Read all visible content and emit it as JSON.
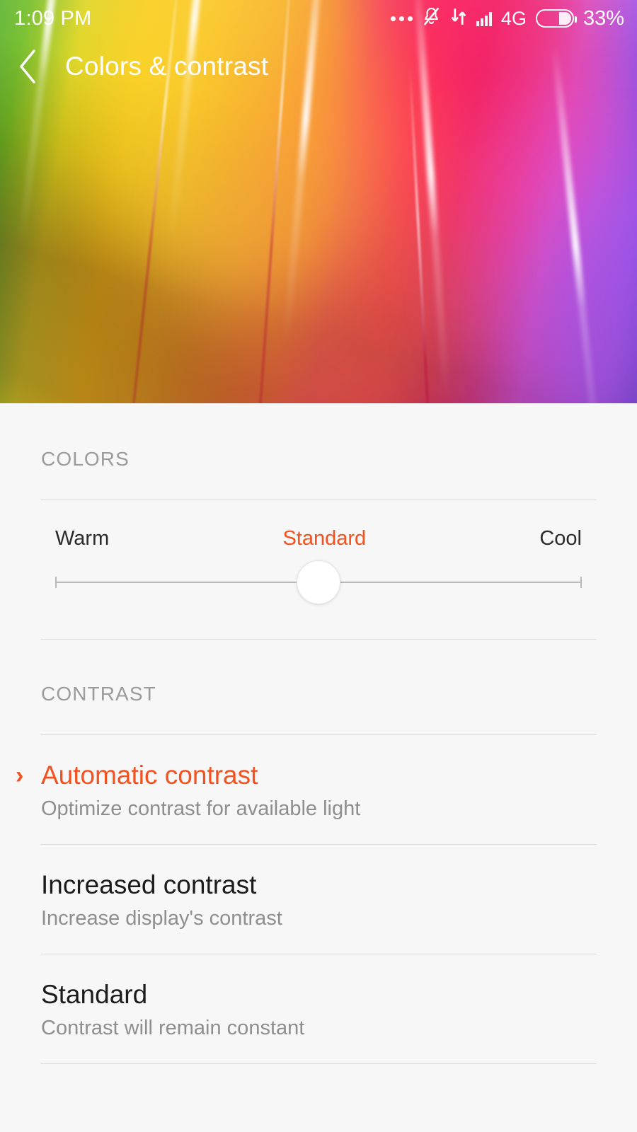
{
  "status_bar": {
    "time": "1:09 PM",
    "network_label": "4G",
    "battery_percent": "33%",
    "battery_level": 33,
    "icons": [
      "more-dots-icon",
      "bell-muted-icon",
      "data-transfer-icon",
      "signal-bars-icon",
      "battery-icon"
    ]
  },
  "app_bar": {
    "back_icon": "chevron-left-icon",
    "title": "Colors & contrast"
  },
  "colors_section": {
    "label": "COLORS",
    "slider": {
      "left_label": "Warm",
      "center_label": "Standard",
      "right_label": "Cool",
      "selected": "Standard",
      "position_percent": 50
    }
  },
  "contrast_section": {
    "label": "CONTRAST",
    "options": [
      {
        "title": "Automatic contrast",
        "subtitle": "Optimize contrast for available light",
        "selected": true,
        "marker": "›"
      },
      {
        "title": "Increased contrast",
        "subtitle": "Increase display's contrast",
        "selected": false,
        "marker": ""
      },
      {
        "title": "Standard",
        "subtitle": "Contrast will remain constant",
        "selected": false,
        "marker": ""
      }
    ]
  },
  "colors": {
    "accent": "#f4511e",
    "background": "#f7f7f7",
    "title_text": "#1c1c1c",
    "subtitle_text": "#8e8e8e",
    "section_label": "#9b9b9b",
    "divider": "#dcdcdc",
    "status_bar_text": "#ffffff"
  }
}
